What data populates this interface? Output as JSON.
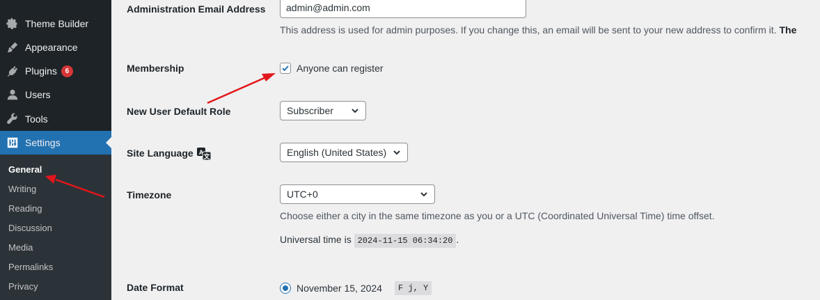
{
  "sidebar": {
    "items": [
      {
        "label": "Theme Builder",
        "icon": "gear-icon"
      },
      {
        "label": "Appearance",
        "icon": "paintbrush-icon"
      },
      {
        "label": "Plugins",
        "icon": "plugin-icon",
        "badge": "6"
      },
      {
        "label": "Users",
        "icon": "user-icon"
      },
      {
        "label": "Tools",
        "icon": "wrench-icon"
      },
      {
        "label": "Settings",
        "icon": "settings-icon",
        "active": true
      }
    ],
    "submenu": [
      "General",
      "Writing",
      "Reading",
      "Discussion",
      "Media",
      "Permalinks",
      "Privacy"
    ],
    "current_submenu": "General"
  },
  "form": {
    "admin_email": {
      "label": "Administration Email Address",
      "value": "admin@admin.com",
      "description": "This address is used for admin purposes. If you change this, an email will be sent to your new address to confirm it.",
      "description_bold": "The"
    },
    "membership": {
      "label": "Membership",
      "checkbox_label": "Anyone can register",
      "checked": true
    },
    "default_role": {
      "label": "New User Default Role",
      "value": "Subscriber"
    },
    "site_language": {
      "label": "Site Language",
      "value": "English (United States)",
      "icon": "translate-icon"
    },
    "timezone": {
      "label": "Timezone",
      "value": "UTC+0",
      "description": "Choose either a city in the same timezone as you or a UTC (Coordinated Universal Time) time offset.",
      "universal_prefix": "Universal time is",
      "universal_time": "2024-11-15 06:34:20",
      "universal_suffix": "."
    },
    "date_format": {
      "label": "Date Format",
      "option_label": "November 15, 2024",
      "option_code": "F j, Y"
    }
  },
  "colors": {
    "sidebar_bg": "#1d2327",
    "accent": "#2271b1",
    "badge": "#d63638",
    "annotation_arrow": "#e3161b"
  }
}
